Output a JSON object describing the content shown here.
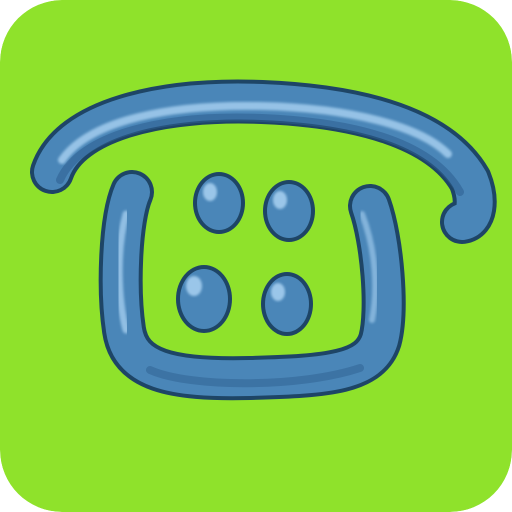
{
  "app_icon": {
    "name": "phone-app-icon",
    "icon": "telephone-icon",
    "colors": {
      "background": "#8fe22b",
      "phone_body": "#4a86b8",
      "phone_highlight": "#a9d2f2",
      "phone_shadow": "#1f4f7c",
      "outline": "#1e4566"
    },
    "keypad": {
      "rows": 2,
      "columns": 2
    }
  }
}
